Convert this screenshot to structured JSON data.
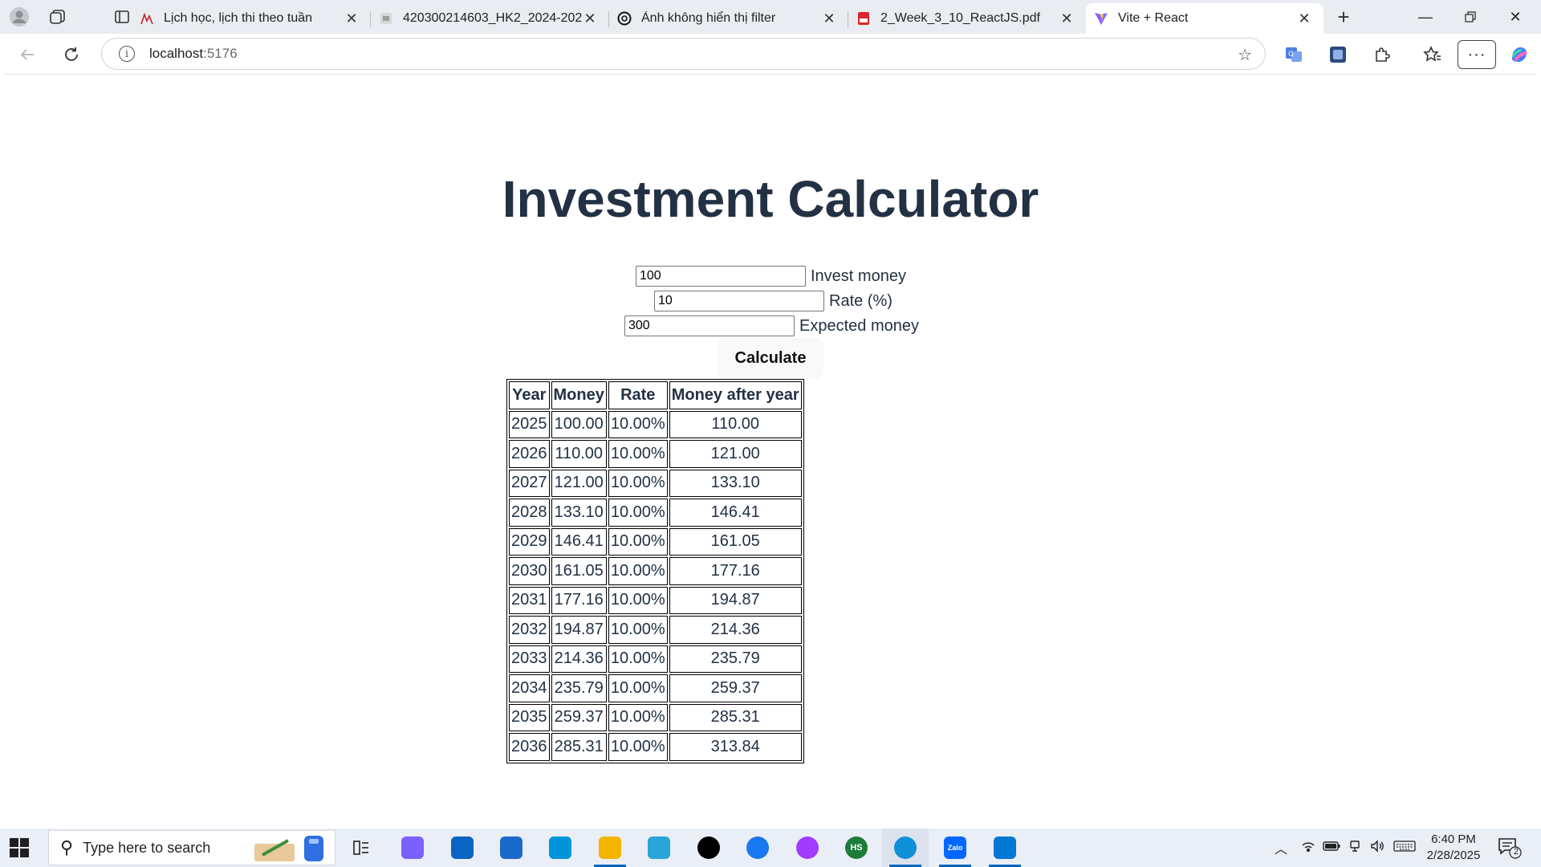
{
  "browser": {
    "tabs": [
      {
        "title": "Lịch học, lịch thi theo tuần",
        "icon": "school-logo-icon"
      },
      {
        "title": "420300214603_HK2_2024-2025: N",
        "icon": "document-icon"
      },
      {
        "title": "Ảnh không hiển thị filter",
        "icon": "chatgpt-icon"
      },
      {
        "title": "2_Week_3_10_ReactJS.pdf",
        "icon": "pdf-icon"
      },
      {
        "title": "Vite + React",
        "icon": "vite-icon"
      }
    ],
    "address": {
      "host": "localhost",
      "port": ":5176"
    }
  },
  "page": {
    "title": "Investment Calculator",
    "fields": [
      {
        "value": "100",
        "label": "Invest money"
      },
      {
        "value": "10",
        "label": "Rate (%)"
      },
      {
        "value": "300",
        "label": "Expected money"
      }
    ],
    "calculate_label": "Calculate",
    "table": {
      "headers": [
        "Year",
        "Money",
        "Rate",
        "Money after year"
      ],
      "rows": [
        [
          "2025",
          "100.00",
          "10.00%",
          "110.00"
        ],
        [
          "2026",
          "110.00",
          "10.00%",
          "121.00"
        ],
        [
          "2027",
          "121.00",
          "10.00%",
          "133.10"
        ],
        [
          "2028",
          "133.10",
          "10.00%",
          "146.41"
        ],
        [
          "2029",
          "146.41",
          "10.00%",
          "161.05"
        ],
        [
          "2030",
          "161.05",
          "10.00%",
          "177.16"
        ],
        [
          "2031",
          "177.16",
          "10.00%",
          "194.87"
        ],
        [
          "2032",
          "194.87",
          "10.00%",
          "214.36"
        ],
        [
          "2033",
          "214.36",
          "10.00%",
          "235.79"
        ],
        [
          "2034",
          "235.79",
          "10.00%",
          "259.37"
        ],
        [
          "2035",
          "259.37",
          "10.00%",
          "285.31"
        ],
        [
          "2036",
          "285.31",
          "10.00%",
          "313.84"
        ]
      ]
    }
  },
  "taskbar": {
    "search_placeholder": "Type here to search",
    "time": "6:40 PM",
    "date": "2/28/2025",
    "notification_count": "2",
    "apps": [
      {
        "name": "copilot-icon",
        "color": "#7b61ff"
      },
      {
        "name": "outlook-icon",
        "color": "#0a64c2"
      },
      {
        "name": "microsoft-store-icon",
        "color": "#1b6ac9"
      },
      {
        "name": "snipping-tool-icon",
        "color": "#0095d9"
      },
      {
        "name": "file-explorer-icon",
        "color": "#f4b400"
      },
      {
        "name": "photos-icon",
        "color": "#2aa5d8"
      },
      {
        "name": "tiktok-icon",
        "color": "#000000"
      },
      {
        "name": "facebook-icon",
        "color": "#1877f2"
      },
      {
        "name": "messenger-icon",
        "color": "#a33bff"
      },
      {
        "name": "hs-app-icon",
        "color": "#1c7c3a",
        "text": "HS"
      },
      {
        "name": "edge-icon",
        "color": "#0f8fd8"
      },
      {
        "name": "zalo-icon",
        "color": "#0068ff",
        "text": "Zalo"
      },
      {
        "name": "vscode-icon",
        "color": "#0078d4"
      }
    ]
  },
  "colors": {
    "title": "#233144",
    "accent": "#0067c0"
  }
}
